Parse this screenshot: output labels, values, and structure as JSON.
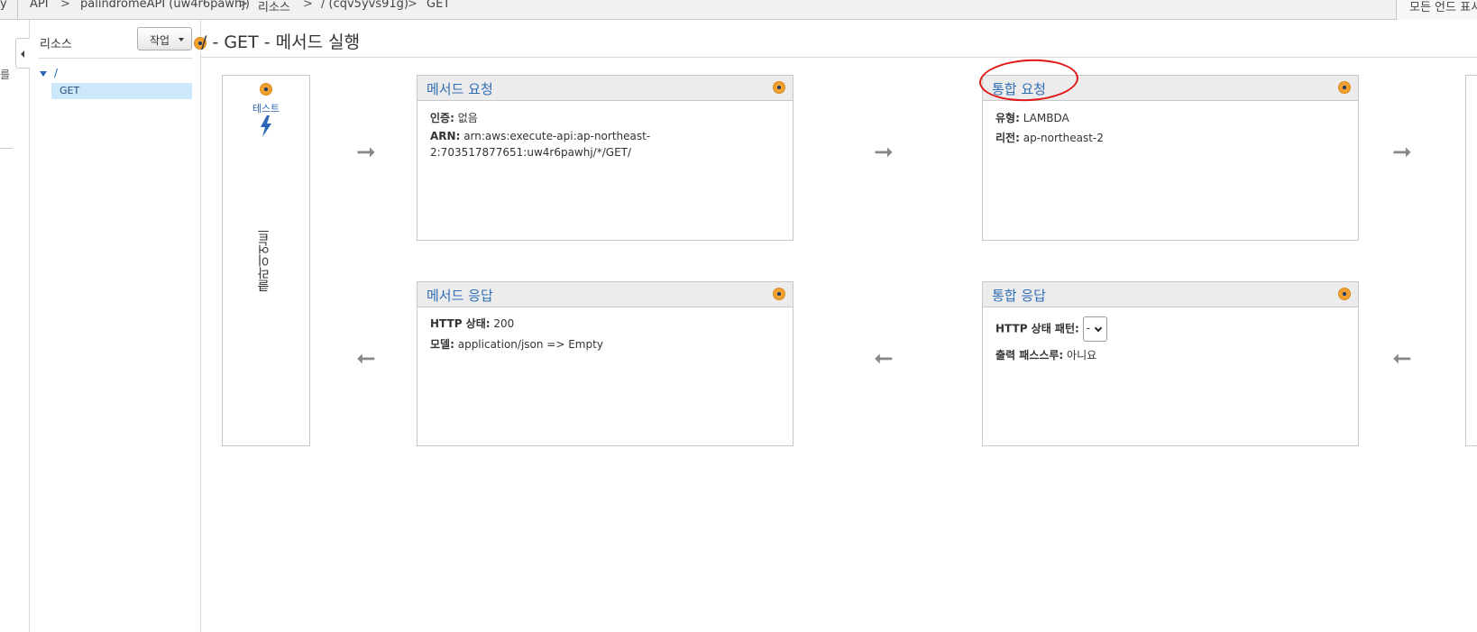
{
  "breadcrumb": {
    "leading_fragment": "y",
    "items": [
      "API",
      "palindromeAPI (uw4r6pawhj)",
      "리소스",
      "/ (cqv5yvs91g)",
      "GET"
    ],
    "separator": ">",
    "right_button": "모든 언드 표시"
  },
  "left_nav": {
    "glyph": "를"
  },
  "resources": {
    "title": "리소스",
    "action_button": "작업",
    "tree": {
      "root": "/",
      "child": "GET"
    }
  },
  "page_title": "/ - GET - 메서드 실행",
  "client": {
    "test_label": "테스트",
    "vertical_label": "클라이언트"
  },
  "method_request": {
    "title": "메서드 요청",
    "auth_label": "인증:",
    "auth_value": "없음",
    "arn_label": "ARN:",
    "arn_line1": "arn:aws:execute-api:ap-northeast-",
    "arn_line2": "2:703517877651:uw4r6pawhj/*/GET/"
  },
  "integration_request": {
    "title": "통합 요청",
    "type_label": "유형:",
    "type_value": "LAMBDA",
    "region_label": "리전:",
    "region_value": "ap-northeast-2"
  },
  "method_response": {
    "title": "메서드 응답",
    "status_label": "HTTP 상태:",
    "status_value": "200",
    "model_label": "모델:",
    "model_value": "application/json => Empty"
  },
  "integration_response": {
    "title": "통합 응답",
    "pattern_label": "HTTP 상태 패턴:",
    "pattern_value": "-",
    "passthrough_label": "출력 패스스루:",
    "passthrough_value": "아니요"
  },
  "colors": {
    "accent": "#2f6db5",
    "marker": "#f0a030",
    "annotation": "#e01818",
    "selected": "#cde8fb"
  },
  "icons": {
    "marker": "orange-dot-icon",
    "test": "lightning-bolt-icon",
    "arrow_right": "arrow-right-icon",
    "arrow_left": "arrow-left-icon"
  }
}
